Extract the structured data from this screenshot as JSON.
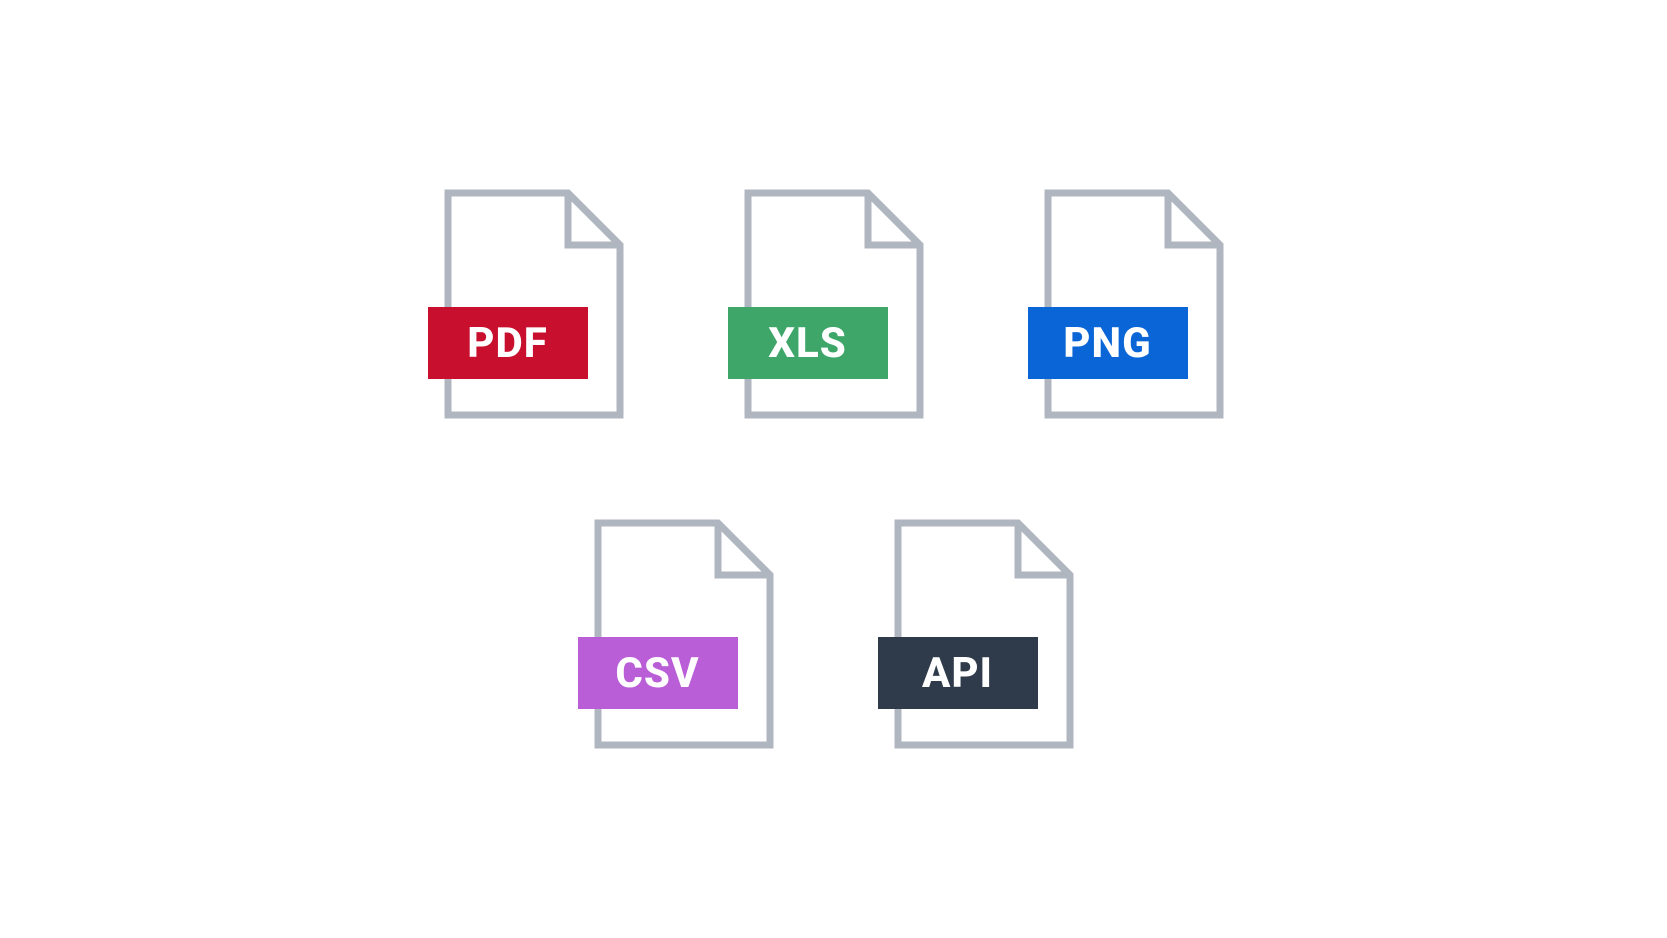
{
  "files": [
    {
      "label": "PDF",
      "color": "#c8102e",
      "name": "pdf-file-icon"
    },
    {
      "label": "XLS",
      "color": "#3fa66a",
      "name": "xls-file-icon"
    },
    {
      "label": "PNG",
      "color": "#0a66d6",
      "name": "png-file-icon"
    },
    {
      "label": "CSV",
      "color": "#b95ed6",
      "name": "csv-file-icon"
    },
    {
      "label": "API",
      "color": "#2f3a4a",
      "name": "api-file-icon"
    }
  ]
}
